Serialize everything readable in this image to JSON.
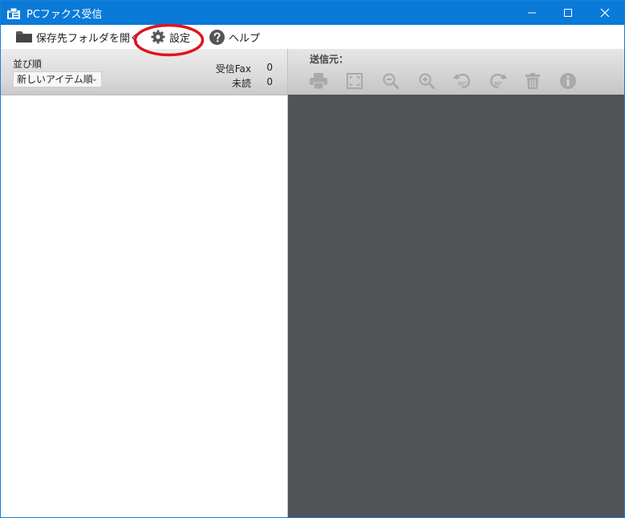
{
  "window": {
    "title": "PCファクス受信",
    "title_bar_color": "#0a7ad8"
  },
  "menu": {
    "open_folder": "保存先フォルダを開く",
    "settings": "設定",
    "help": "ヘルプ"
  },
  "left_panel": {
    "sort_label": "並び順",
    "sort_value": "新しいアイテム順",
    "received_label": "受信Fax",
    "received_count": "0",
    "unread_label": "未読",
    "unread_count": "0"
  },
  "right_panel": {
    "sender_label": "送信元：",
    "tools": [
      "print-icon",
      "fit-icon",
      "zoom-out-icon",
      "zoom-in-icon",
      "rotate-left-90-icon",
      "rotate-right-90-icon",
      "trash-icon",
      "info-icon"
    ],
    "rotate_left_text": "90°",
    "rotate_right_text": "90°",
    "viewer_color": "#515457"
  },
  "annotation": {
    "highlight_color": "#e0141e"
  }
}
